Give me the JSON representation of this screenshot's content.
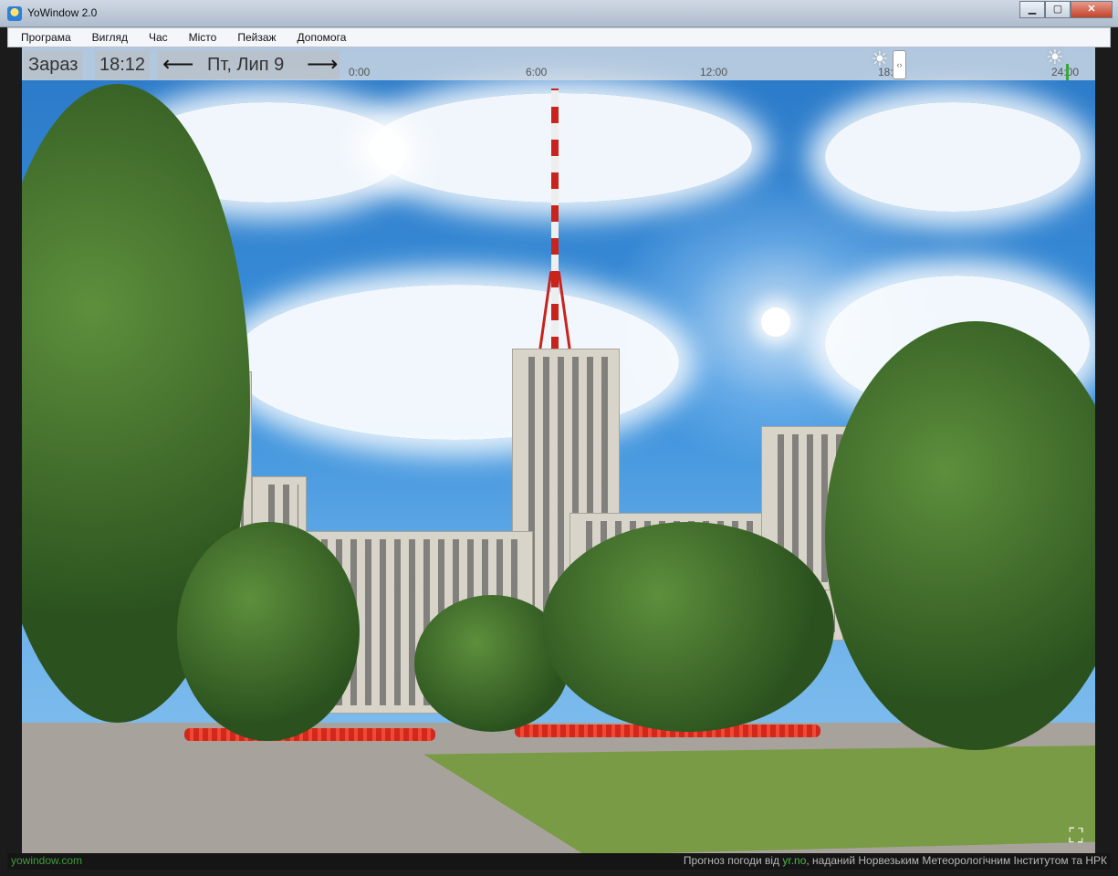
{
  "window": {
    "title": "YoWindow 2.0",
    "min": "▁",
    "max": "▢",
    "close": "✕"
  },
  "menu": [
    "Програма",
    "Вигляд",
    "Час",
    "Місто",
    "Пейзаж",
    "Допомога"
  ],
  "timebar": {
    "now_label": "Зараз",
    "time": "18:12",
    "prev_arrow": "⟵",
    "date": "Пт, Лип 9",
    "next_arrow": "⟶",
    "hour_ticks": [
      "0:00",
      "6:00",
      "12:00",
      "18:00",
      "24:00"
    ],
    "slider_grip": "‹›"
  },
  "icons": {
    "app": "yowindow-app-icon",
    "sunset": "sun-icon",
    "sunrise": "sun-icon",
    "fullscreen": "fullscreen-icon"
  },
  "footer": {
    "site": "yowindow.com",
    "credit_prefix": "Прогноз погоди від ",
    "credit_link": "yr.no",
    "credit_suffix": ", наданий Норвезьким Метеорологічним Інститутом та НРК"
  },
  "colors": {
    "sky": "#3d92dc",
    "accent_green": "#3f9b3b",
    "slider_marker": "#39a83a"
  }
}
